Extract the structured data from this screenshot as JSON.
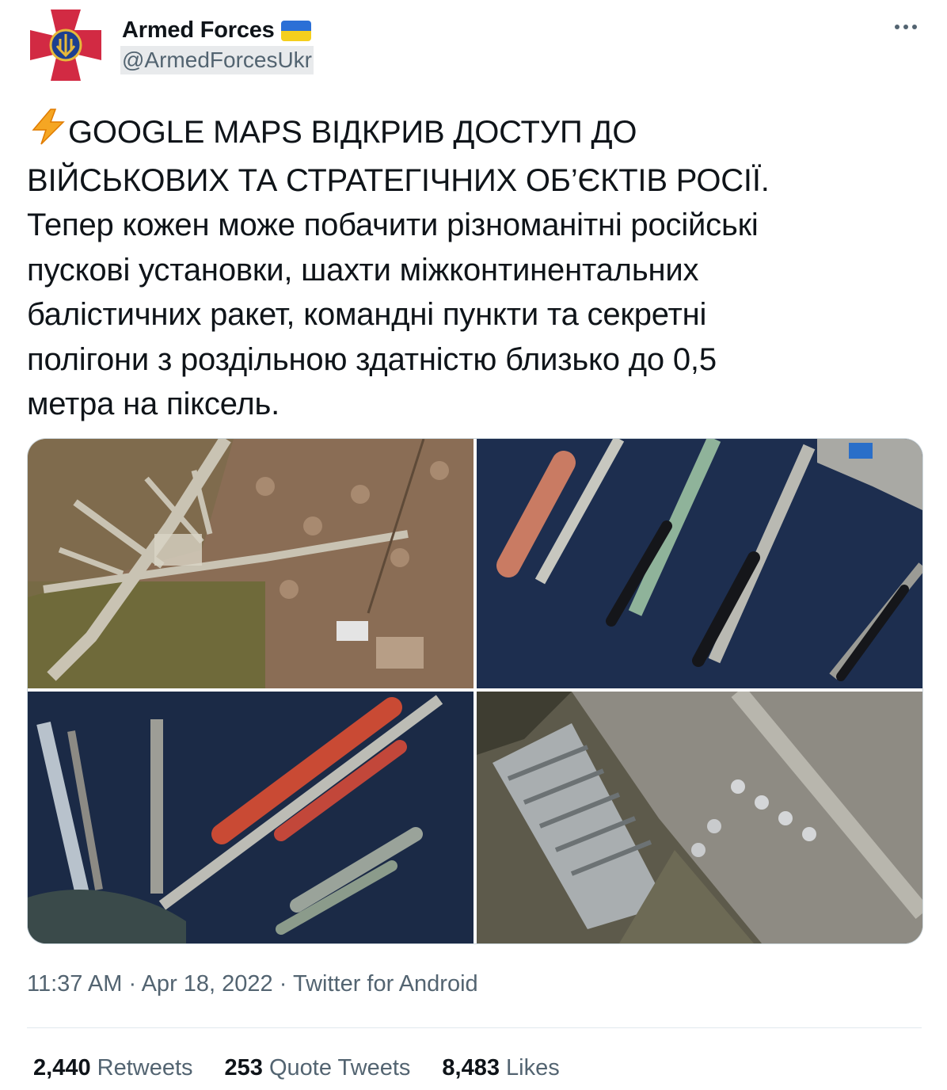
{
  "tweet": {
    "author": {
      "display_name": "Armed Forces",
      "flag_icon": "ukraine-flag-icon",
      "handle": "@ArmedForcesUkr",
      "avatar": "armed-forces-emblem"
    },
    "more_icon": "more-horizontal-icon",
    "text_emoji_icon": "high-voltage-icon",
    "text": "GOOGLE MAPS ВІДКРИВ ДОСТУП ДО\nВІЙСЬКОВИХ ТА СТРАТЕГІЧНИХ ОБ’ЄКТІВ РОСІЇ.\nТепер кожен може побачити різноманітні російські\nпускові установки, шахти міжконтинентальних\nбалістичних ракет, командні пункти та секретні\nполігони з роздільною здатністю близько до 0,5\nметра на піксель.",
    "media": [
      {
        "kind": "satellite-airfield"
      },
      {
        "kind": "satellite-submarine-piers"
      },
      {
        "kind": "satellite-warships-harbor"
      },
      {
        "kind": "satellite-hangars-aircraft"
      }
    ],
    "time": "11:37 AM",
    "separator": "·",
    "date": "Apr 18, 2022",
    "source": "Twitter for Android",
    "stats": {
      "retweets_count": "2,440",
      "retweets_label": "Retweets",
      "quotes_count": "253",
      "quotes_label": "Quote Tweets",
      "likes_count": "8,483",
      "likes_label": "Likes"
    }
  },
  "colors": {
    "text": "#0f1419",
    "secondary": "#536471",
    "border": "#cfd9de",
    "emblem_red": "#d22a43",
    "emblem_blue": "#1d3f8f",
    "emblem_gold": "#e6b83a"
  }
}
